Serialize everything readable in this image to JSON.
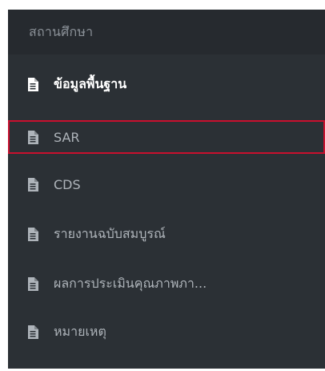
{
  "sidebar": {
    "section_title": "สถานศึกษา",
    "items": [
      {
        "label": "ข้อมูลพื้นฐาน",
        "icon": "document-icon",
        "state": "active"
      },
      {
        "label": "SAR",
        "icon": "document-icon",
        "state": "highlighted"
      },
      {
        "label": "CDS",
        "icon": "document-icon",
        "state": "normal"
      },
      {
        "label": "รายงานฉบับสมบูรณ์",
        "icon": "document-icon",
        "state": "normal"
      },
      {
        "label": "ผลการประเมินคุณภาพภา...",
        "icon": "document-icon",
        "state": "normal"
      },
      {
        "label": "หมายเหตุ",
        "icon": "document-icon",
        "state": "normal"
      }
    ]
  },
  "colors": {
    "sidebar_bg": "#2b3035",
    "header_bg": "#262a2f",
    "text_muted": "#aeb4ba",
    "text_active": "#ffffff",
    "highlight_border": "#c8102e"
  }
}
